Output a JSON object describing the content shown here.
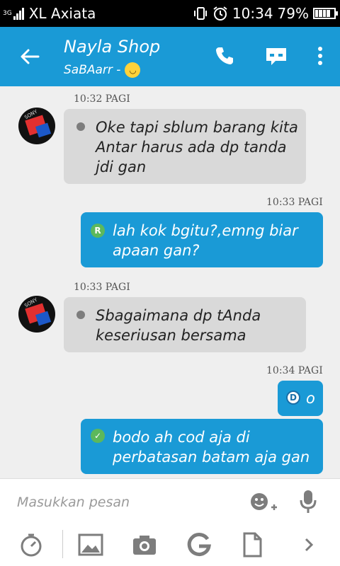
{
  "status_bar": {
    "network_type": "3G",
    "carrier": "XL Axiata",
    "time": "10:34",
    "battery": "79%"
  },
  "header": {
    "title": "Nayla Shop",
    "subtitle": "SaBAarr -",
    "emoji_icon": "yawn-emoji-icon",
    "back_icon": "arrow-left-icon",
    "call_icon": "phone-icon",
    "video_icon": "mask-icon",
    "menu_icon": "more-vertical-icon",
    "color": "#1a9ad6"
  },
  "messages": [
    {
      "direction": "in",
      "time": "10:32 PAGI",
      "lines": [
        "Oke tapi sblum barang kita",
        "Antar harus ada dp tanda",
        "jdi gan"
      ]
    },
    {
      "direction": "out",
      "time": "10:33 PAGI",
      "mark": "R",
      "lines": [
        "lah kok bgitu?,emng biar",
        "apaan gan?"
      ]
    },
    {
      "direction": "in",
      "time": "10:33 PAGI",
      "lines": [
        "Sbagaimana dp tAnda",
        "keseriusan bersama"
      ]
    },
    {
      "direction": "out",
      "time": "10:34 PAGI",
      "mark": "D",
      "lines": [
        "o"
      ]
    },
    {
      "direction": "out",
      "time": "",
      "mark": "check",
      "lines": [
        "bodo ah cod aja di",
        "perbatasan batam aja gan"
      ]
    }
  ],
  "input": {
    "placeholder": "Masukkan pesan",
    "value": ""
  },
  "toolbar": {
    "items": [
      "timer-icon",
      "image-icon",
      "camera-icon",
      "google-icon",
      "document-icon",
      "chevron-right-icon"
    ]
  }
}
